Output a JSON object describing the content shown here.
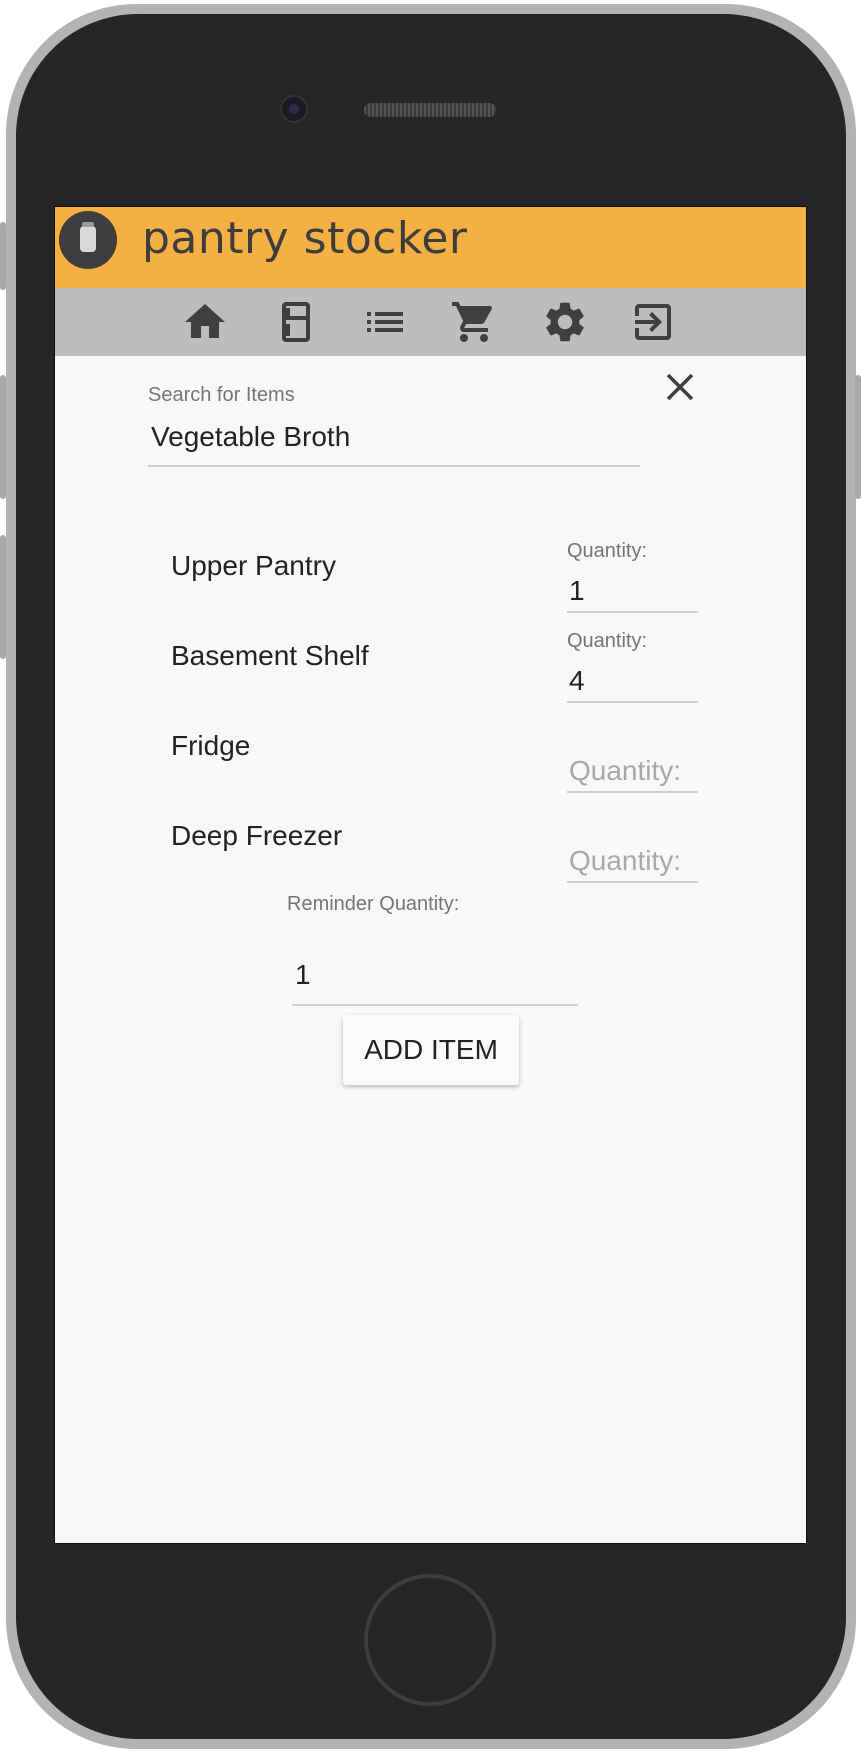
{
  "app": {
    "title": "pantry stocker",
    "logo_icon": "jar-icon",
    "brand_color": "#f4b042",
    "nav_color": "#bdbdbd"
  },
  "nav": {
    "items": [
      {
        "name": "home",
        "icon": "home-icon"
      },
      {
        "name": "pantry",
        "icon": "fridge-icon"
      },
      {
        "name": "list",
        "icon": "list-icon"
      },
      {
        "name": "cart",
        "icon": "cart-icon"
      },
      {
        "name": "settings",
        "icon": "gear-icon"
      },
      {
        "name": "logout",
        "icon": "exit-icon"
      }
    ]
  },
  "search": {
    "label": "Search for Items",
    "value": "Vegetable Broth",
    "clear_icon": "close-icon"
  },
  "locations": [
    {
      "name": "Upper Pantry",
      "quantity_label": "Quantity:",
      "quantity": "1"
    },
    {
      "name": "Basement Shelf",
      "quantity_label": "Quantity:",
      "quantity": "4"
    },
    {
      "name": "Fridge",
      "quantity_placeholder": "Quantity:",
      "quantity": ""
    },
    {
      "name": "Deep Freezer",
      "quantity_placeholder": "Quantity:",
      "quantity": ""
    }
  ],
  "reminder": {
    "label": "Reminder Quantity:",
    "value": "1"
  },
  "add_button": {
    "label": "ADD ITEM"
  }
}
